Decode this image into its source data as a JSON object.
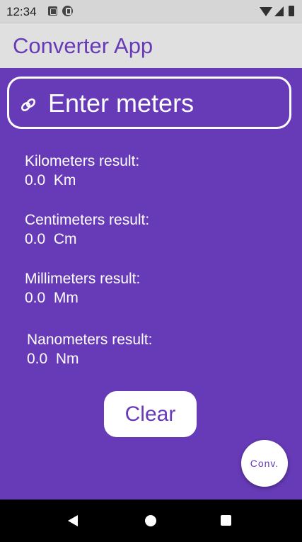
{
  "status_bar": {
    "time": "12:34",
    "icons": [
      "notification-a-icon",
      "notification-p-icon",
      "wifi-icon",
      "signal-icon",
      "battery-icon"
    ]
  },
  "app_bar": {
    "title": "Converter App"
  },
  "input": {
    "placeholder": "Enter meters",
    "value": "",
    "icon": "link-icon"
  },
  "results": {
    "kilometers": {
      "label": "Kilometers result:",
      "value": "0.0",
      "unit": "Km"
    },
    "centimeters": {
      "label": "Centimeters result:",
      "value": "0.0",
      "unit": "Cm"
    },
    "millimeters": {
      "label": "Millimeters result:",
      "value": "0.0",
      "unit": "Mm"
    },
    "nanometers": {
      "label": "Nanometers result:",
      "value": "0.0",
      "unit": "Nm"
    }
  },
  "buttons": {
    "clear_label": "Clear",
    "convert_label": "Conv."
  },
  "colors": {
    "primary": "#673ab7",
    "app_bar": "#e0e0e0",
    "status_bar": "#d6d6d6",
    "nav_bar": "#000000",
    "surface": "#ffffff"
  }
}
